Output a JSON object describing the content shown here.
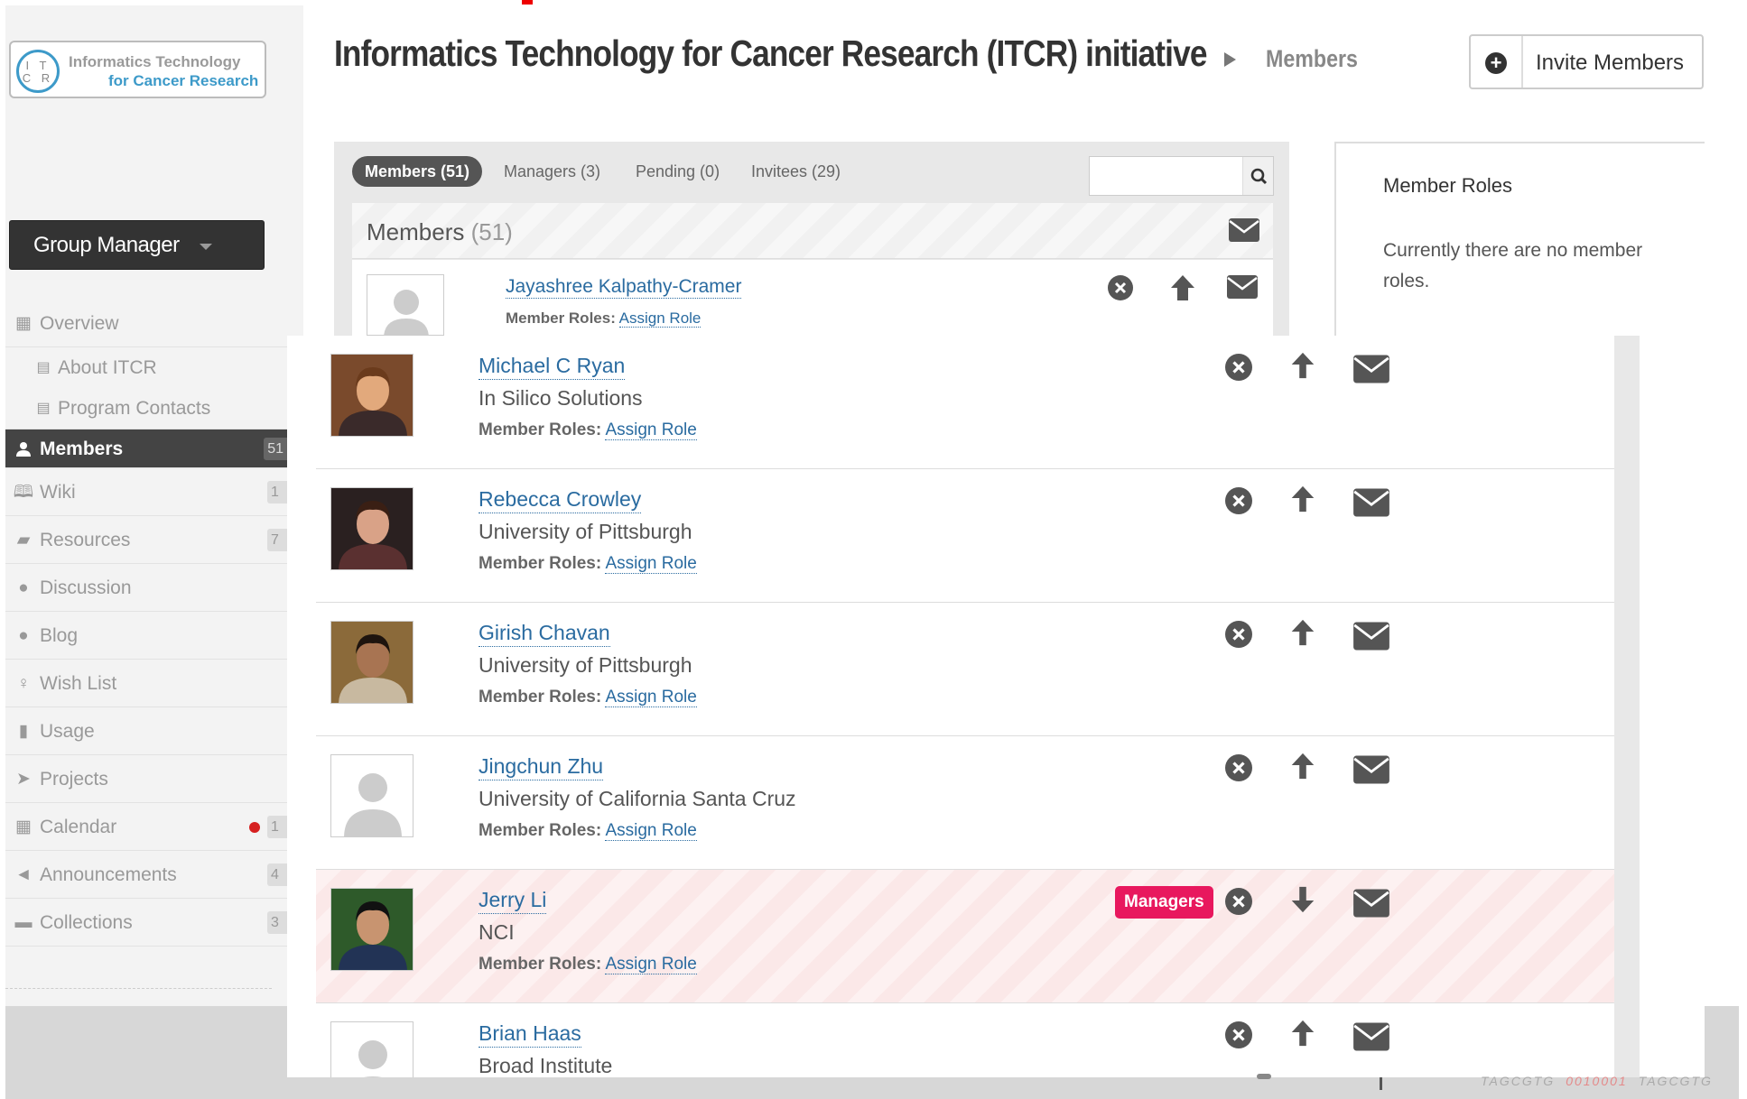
{
  "logo": {
    "ring_line1": "I T",
    "ring_line2": "C R",
    "title_line1": "Informatics Technology",
    "title_line2": "for Cancer Research"
  },
  "group_manager": {
    "label": "Group Manager"
  },
  "nav": {
    "overview": "Overview",
    "about": "About ITCR",
    "program_contacts": "Program Contacts",
    "members": {
      "label": "Members",
      "count": "51"
    },
    "wiki": {
      "label": "Wiki",
      "count": "1"
    },
    "resources": {
      "label": "Resources",
      "count": "7"
    },
    "discussion": "Discussion",
    "blog": "Blog",
    "wish_list": "Wish List",
    "usage": "Usage",
    "projects": "Projects",
    "calendar": {
      "label": "Calendar",
      "count": "1"
    },
    "announcements": {
      "label": "Announcements",
      "count": "4"
    },
    "collections": {
      "label": "Collections",
      "count": "3"
    }
  },
  "header": {
    "title": "Informatics Technology for Cancer Research (ITCR) initiative",
    "breadcrumb_current": "Members",
    "invite_button": "Invite Members"
  },
  "tabs": {
    "members": "Members (51)",
    "managers": "Managers (3)",
    "pending": "Pending (0)",
    "invitees": "Invitees (29)"
  },
  "members_header": {
    "title": "Members",
    "count": "(51)"
  },
  "roles_panel": {
    "title": "Member Roles",
    "text": "Currently there are no member roles."
  },
  "member_roles_label": "Member Roles:",
  "assign_role_label": "Assign Role",
  "first_member": {
    "name": "Jayashree Kalpathy-Cramer"
  },
  "members": [
    {
      "name": "Michael C Ryan",
      "org": "In Silico Solutions",
      "badge": ""
    },
    {
      "name": "Rebecca Crowley",
      "org": "University of Pittsburgh",
      "badge": ""
    },
    {
      "name": "Girish Chavan",
      "org": "University of Pittsburgh",
      "badge": ""
    },
    {
      "name": "Jingchun Zhu",
      "org": "University of California Santa Cruz",
      "badge": ""
    },
    {
      "name": "Jerry Li",
      "org": "NCI",
      "badge": "Managers"
    },
    {
      "name": "Brian Haas",
      "org": "Broad Institute",
      "badge": ""
    }
  ],
  "colors": {
    "link": "#2a6ba0",
    "manager_badge": "#e8185e",
    "active_nav": "#444444",
    "calendar_dot": "#d62020"
  },
  "icons": {
    "remove": "remove-circle-icon",
    "promote": "arrow-up-icon",
    "demote": "arrow-down-icon",
    "message": "envelope-icon",
    "search": "search-icon"
  },
  "footer_deco": [
    "TAGCGTG",
    "0010001",
    "TAGCGTG"
  ]
}
